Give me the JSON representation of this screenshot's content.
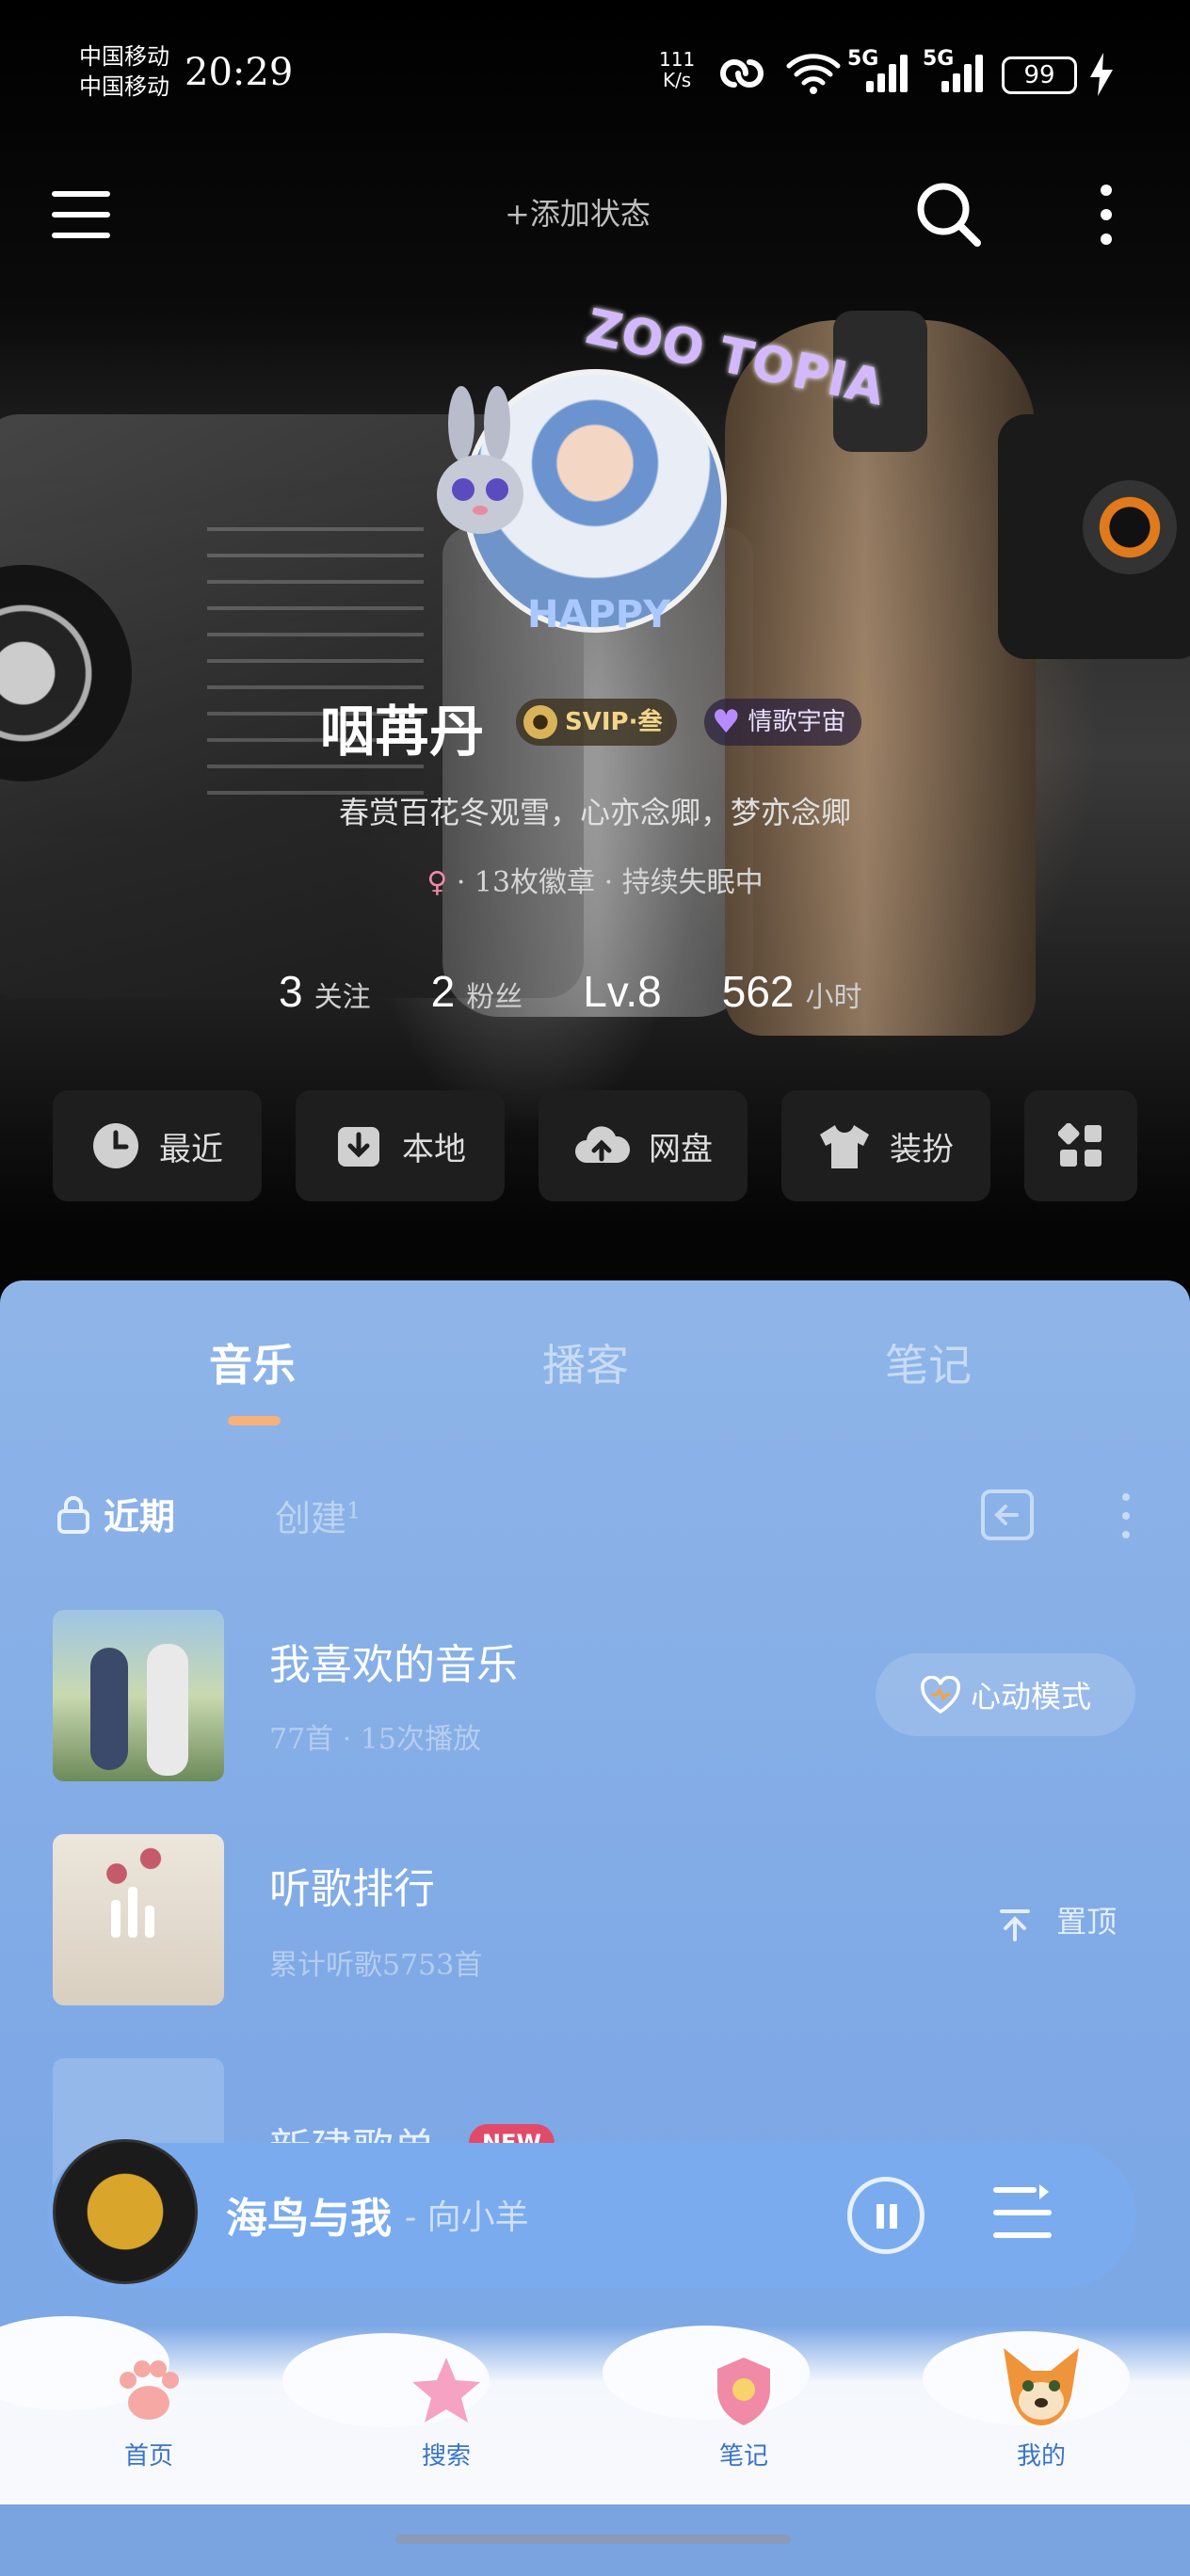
{
  "status_bar": {
    "carrier_1": "中国移动",
    "carrier_2": "中国移动",
    "time": "20:29",
    "net_speed_value": "111",
    "net_speed_unit": "K/s",
    "sig1": "5G",
    "sig2": "5G",
    "battery": "99"
  },
  "top_nav": {
    "add_status": "+添加状态",
    "menu_icon": "hamburger-icon",
    "search_icon": "search-icon",
    "more_icon": "more-vertical-icon"
  },
  "profile": {
    "username": "咽苒丹",
    "svip_badge": "SVIP·叁",
    "love_badge": "情歌宇宙",
    "bio": "春赏百花冬观雪，心亦念卿，梦亦念卿",
    "meta": "· 13枚徽章 · 持续失眠中",
    "avatar_sticker_top": "ZOO TOPIA",
    "avatar_sticker_bottom": "HAPPY",
    "stats": [
      {
        "num": "3",
        "label": "关注"
      },
      {
        "num": "2",
        "label": "粉丝"
      },
      {
        "num": "Lv.8",
        "label": ""
      },
      {
        "num": "562",
        "label": "小时"
      }
    ]
  },
  "quick_actions": [
    {
      "label": "最近",
      "icon": "clock-icon"
    },
    {
      "label": "本地",
      "icon": "download-icon"
    },
    {
      "label": "网盘",
      "icon": "cloud-upload-icon"
    },
    {
      "label": "装扮",
      "icon": "tshirt-icon"
    },
    {
      "label": "",
      "icon": "apps-grid-icon"
    }
  ],
  "content_tabs": [
    {
      "label": "音乐",
      "active": true
    },
    {
      "label": "播客",
      "active": false
    },
    {
      "label": "笔记",
      "active": false
    }
  ],
  "sub_tabs": {
    "recent": "近期",
    "create": "创建",
    "create_count": "1"
  },
  "playlists": [
    {
      "title": "我喜欢的音乐",
      "subtitle": "77首 · 15次播放",
      "action": "心动模式"
    },
    {
      "title": "听歌排行",
      "subtitle": "累计听歌5753首",
      "action": "置顶"
    },
    {
      "title": "新建歌单",
      "badge": "NEW"
    }
  ],
  "player": {
    "song": "海鸟与我",
    "artist": "- 向小羊"
  },
  "bottom_nav": [
    {
      "label": "首页",
      "icon": "paw-icon"
    },
    {
      "label": "搜索",
      "icon": "star-icon"
    },
    {
      "label": "笔记",
      "icon": "badge-icon"
    },
    {
      "label": "我的",
      "icon": "fox-icon"
    }
  ],
  "colors": {
    "panel_blue": "#8fb5e8",
    "tab_indicator": "#f6b27a",
    "new_badge": "#e24a6a",
    "svip_gold": "#f3d68a"
  }
}
